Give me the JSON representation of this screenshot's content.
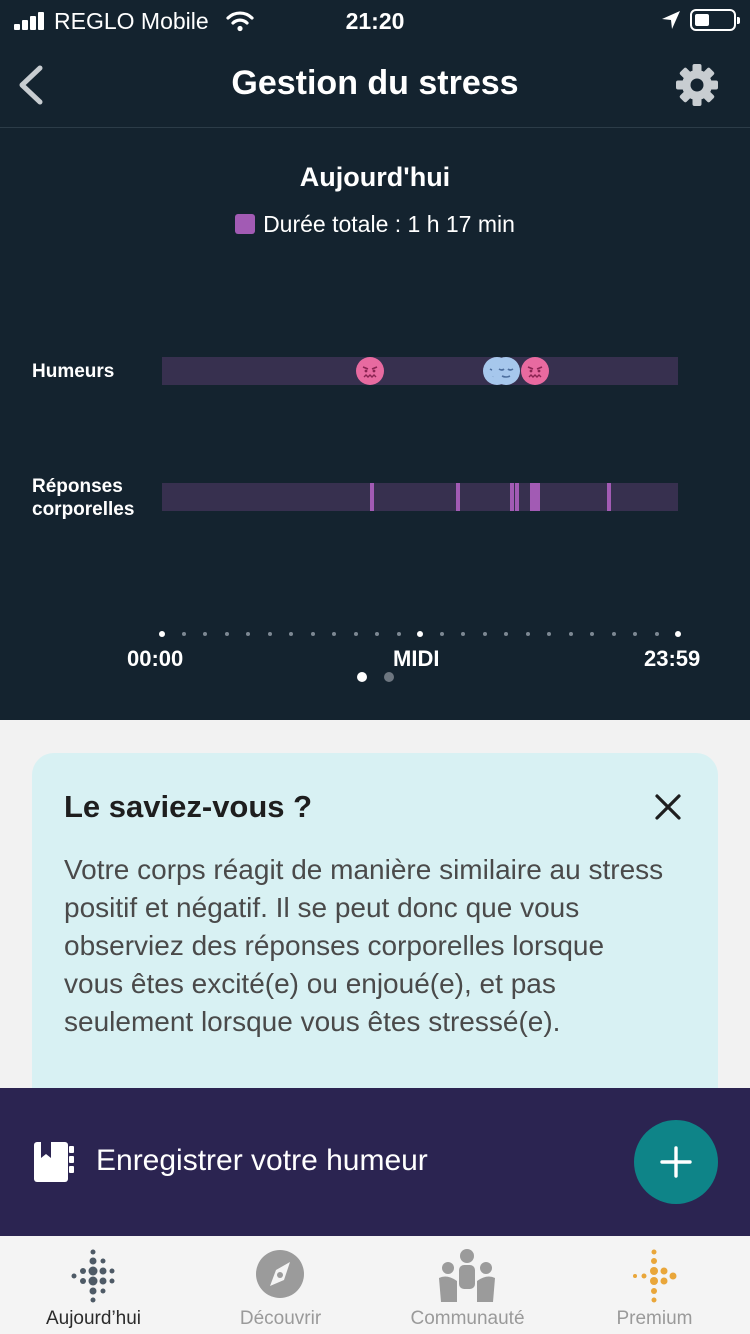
{
  "status_bar": {
    "carrier": "REGLO Mobile",
    "time": "21:20"
  },
  "header": {
    "title": "Gestion du stress"
  },
  "chart_data": {
    "type": "timeline",
    "title": "Aujourd'hui",
    "legend": "Durée totale : 1 h 17 min",
    "x_labels": [
      "00:00",
      "MIDI",
      "23:59"
    ],
    "x_range": [
      "00:00",
      "23:59"
    ],
    "rows": [
      {
        "name": "Humeurs",
        "marks": [
          {
            "time": "09:40",
            "mood": "stressed"
          },
          {
            "time": "15:35",
            "mood": "calm"
          },
          {
            "time": "16:00",
            "mood": "calm"
          },
          {
            "time": "17:20",
            "mood": "stressed"
          }
        ]
      },
      {
        "name": "Réponses corporelles",
        "marks": [
          {
            "start": "09:40",
            "duration_min": 10
          },
          {
            "start": "13:40",
            "duration_min": 8
          },
          {
            "start": "16:10",
            "duration_min": 5
          },
          {
            "start": "16:25",
            "duration_min": 5
          },
          {
            "start": "17:05",
            "duration_min": 30
          },
          {
            "start": "20:40",
            "duration_min": 8
          }
        ]
      }
    ],
    "colors": {
      "mark": "#a25bb4",
      "track": "#37304f",
      "stressed": "#e86aa0",
      "calm": "#a6c7ec"
    }
  },
  "pager": {
    "count": 2,
    "active": 0
  },
  "tip": {
    "title": "Le saviez-vous ?",
    "body": "Votre corps réagit de manière similaire au stress positif et négatif. Il se peut donc que vous observiez des réponses corporelles lorsque vous êtes excité(e) ou enjoué(e), et pas seulement lorsque vous êtes stressé(e)."
  },
  "record": {
    "label": "Enregistrer votre humeur"
  },
  "tabs": [
    {
      "label": "Aujourd’hui",
      "icon": "fitbit-dots-icon",
      "active": true
    },
    {
      "label": "Découvrir",
      "icon": "compass-icon",
      "active": false
    },
    {
      "label": "Communauté",
      "icon": "community-icon",
      "active": false
    },
    {
      "label": "Premium",
      "icon": "premium-dots-icon",
      "active": false
    }
  ]
}
